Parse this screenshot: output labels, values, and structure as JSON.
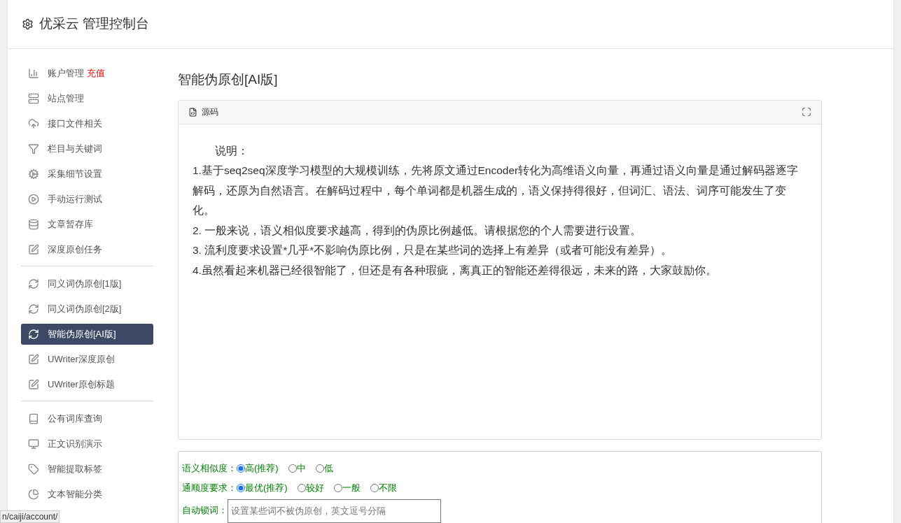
{
  "header": {
    "title": "优采云 管理控制台"
  },
  "sidebar": {
    "groups": [
      {
        "items": [
          {
            "label": "账户管理",
            "badge": "充值",
            "selected": false
          },
          {
            "label": "站点管理",
            "selected": false
          },
          {
            "label": "接口文件相关",
            "selected": false
          },
          {
            "label": "栏目与关键词",
            "selected": false
          },
          {
            "label": "采集细节设置",
            "selected": false
          },
          {
            "label": "手动运行测试",
            "selected": false
          },
          {
            "label": "文章暂存库",
            "selected": false
          },
          {
            "label": "深度原创任务",
            "selected": false
          }
        ]
      },
      {
        "items": [
          {
            "label": "同义词伪原创[1版]",
            "selected": false
          },
          {
            "label": "同义词伪原创[2版]",
            "selected": false
          },
          {
            "label": "智能伪原创[AI版]",
            "selected": true
          },
          {
            "label": "UWriter深度原创",
            "selected": false
          },
          {
            "label": "UWriter原创标题",
            "selected": false
          }
        ]
      },
      {
        "items": [
          {
            "label": "公有词库查询",
            "selected": false
          },
          {
            "label": "正文识别演示",
            "selected": false
          },
          {
            "label": "智能提取标签",
            "selected": false
          },
          {
            "label": "文本智能分类",
            "selected": false
          }
        ]
      }
    ]
  },
  "main": {
    "title": "智能伪原创[AI版]",
    "editor": {
      "tab": "源码",
      "paragraphs": [
        "说明：",
        "1.基于seq2seq深度学习模型的大规模训练，先将原文通过Encoder转化为高维语义向量，再通过语义向量是通过解码器逐字解码，还原为自然语言。在解码过程中，每个单词都是机器生成的，语义保持得很好，但词汇、语法、词序可能发生了变化。",
        "2. 一般来说，语义相似度要求越高，得到的伪原比例越低。请根据您的个人需要进行设置。",
        "3. 流利度要求设置*几乎*不影响伪原比例，只是在某些词的选择上有差异（或者可能没有差异）。",
        "4.虽然看起来机器已经很智能了，但还是有各种瑕疵，离真正的智能还差得很远，未来的路，大家鼓励你。"
      ]
    },
    "options": [
      {
        "label": "语义相似度：",
        "choices": [
          {
            "label": "高(推荐)",
            "selected": true
          },
          {
            "label": "中",
            "selected": false
          },
          {
            "label": "低",
            "selected": false
          }
        ]
      },
      {
        "label": "通顺度要求：",
        "choices": [
          {
            "label": "最优(推荐)",
            "selected": true
          },
          {
            "label": "较好",
            "selected": false
          },
          {
            "label": "一般",
            "selected": false
          },
          {
            "label": "不限",
            "selected": false
          }
        ]
      }
    ],
    "lock": {
      "label": "自动锁词：",
      "placeholder": "设置某些词不被伪原创，英文逗号分隔"
    }
  },
  "status_url": "n/caiji/account/"
}
